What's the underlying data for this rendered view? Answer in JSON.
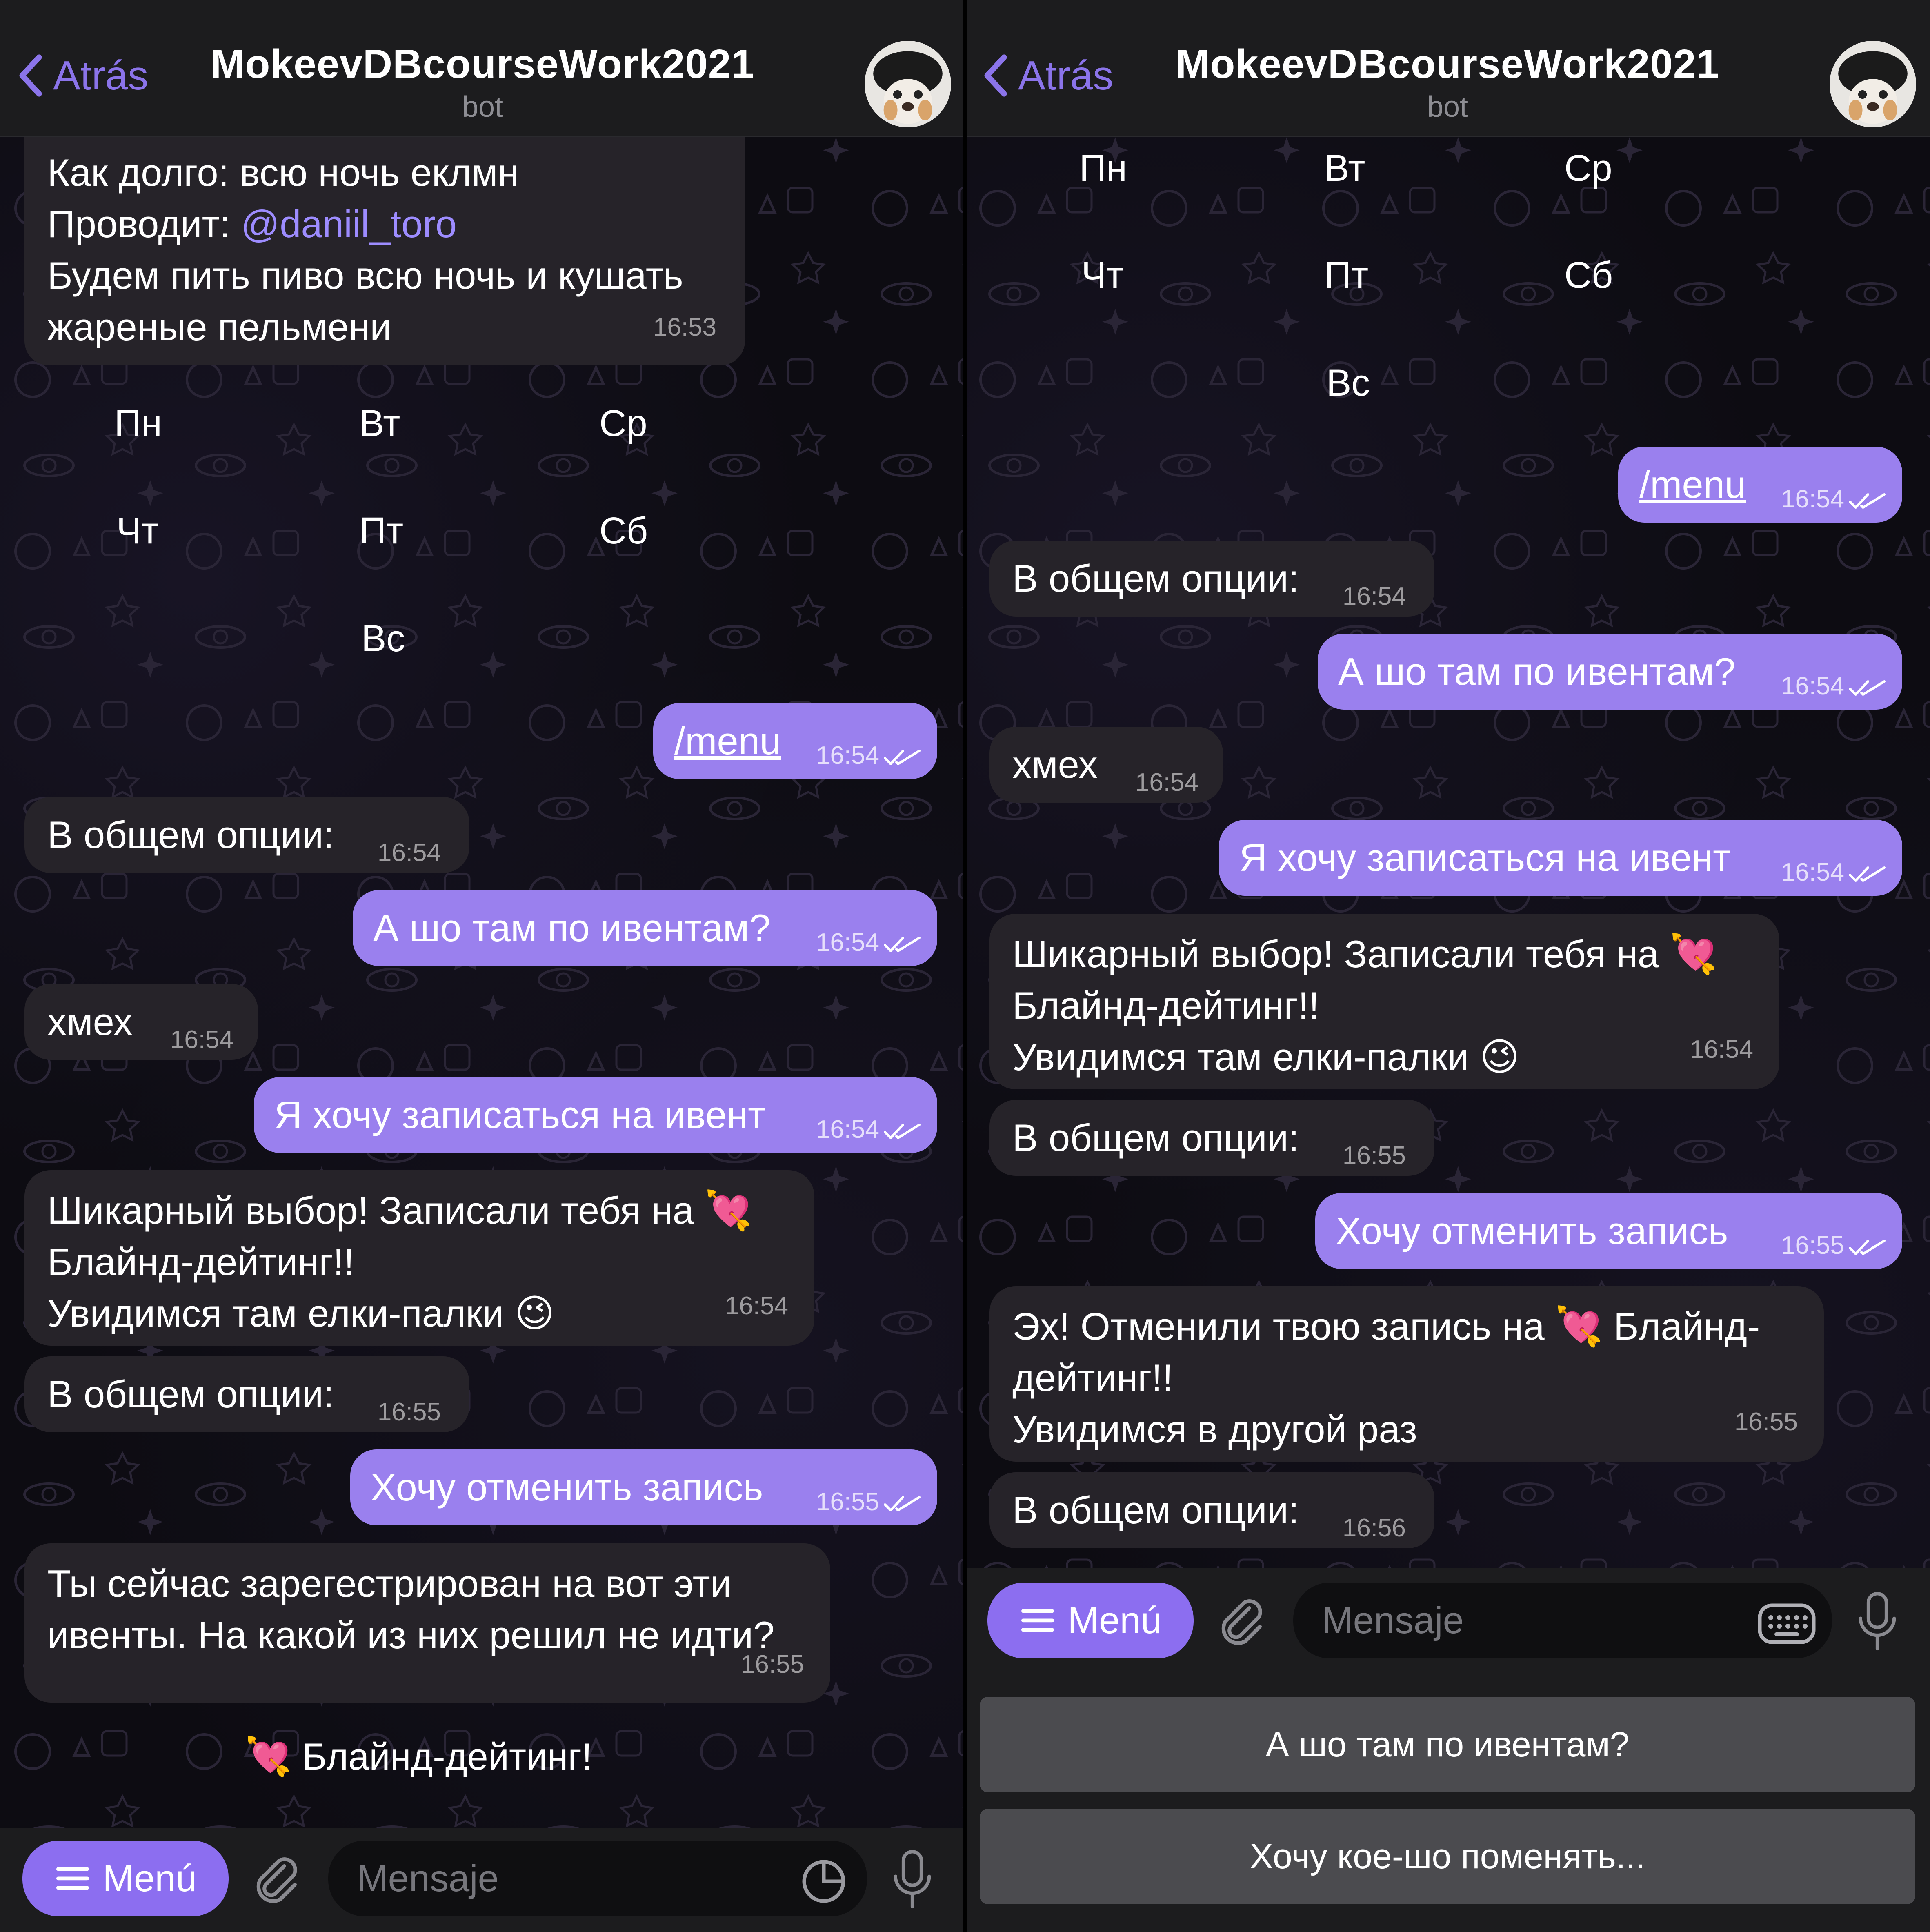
{
  "header": {
    "back_label": "Atrás",
    "title": "MokeevDBcourseWork2021",
    "subtitle": "bot"
  },
  "left": {
    "event_info": {
      "line1": "Как долго: всю ночь еклмн",
      "line2_prefix": "Проводит: ",
      "line2_link": "@daniil_toro",
      "line3": "Будем пить пиво всю ночь и кушать",
      "line4": "жареные пельмени",
      "time": "16:53"
    },
    "days": [
      "Пн",
      "Вт",
      "Ср",
      "Чт",
      "Пт",
      "Сб",
      "Вс"
    ],
    "messages": [
      {
        "text": "/menu",
        "time": "16:54"
      },
      {
        "text": "В общем опции:",
        "time": "16:54"
      },
      {
        "text": "А шо там по ивентам?",
        "time": "16:54"
      },
      {
        "text": "хмех",
        "time": "16:54"
      },
      {
        "text": "Я хочу записаться на ивент",
        "time": "16:54"
      },
      {
        "line1": "Шикарный выбор! Записали тебя на 💘",
        "line2": "Блайнд-дейтинг!!",
        "line3": "Увидимся там елки-палки 😉",
        "time": "16:54"
      },
      {
        "text": "В общем опции:",
        "time": "16:55"
      },
      {
        "text": "Хочу отменить запись",
        "time": "16:55"
      },
      {
        "line1": "Ты сейчас зарегестрирован на вот эти",
        "line2": "ивенты. На какой из них решил не идти?",
        "time": "16:55"
      }
    ],
    "inline_option": "💘 Блайнд-дейтинг!"
  },
  "right": {
    "days": [
      "Пн",
      "Вт",
      "Ср",
      "Чт",
      "Пт",
      "Сб",
      "Вс"
    ],
    "messages": [
      {
        "text": "/menu",
        "time": "16:54"
      },
      {
        "text": "В общем опции:",
        "time": "16:54"
      },
      {
        "text": "А шо там по ивентам?",
        "time": "16:54"
      },
      {
        "text": "хмех",
        "time": "16:54"
      },
      {
        "text": "Я хочу записаться на ивент",
        "time": "16:54"
      },
      {
        "line1": "Шикарный выбор! Записали тебя на 💘",
        "line2": "Блайнд-дейтинг!!",
        "line3": "Увидимся там елки-палки 😉",
        "time": "16:54"
      },
      {
        "text": "В общем опции:",
        "time": "16:55"
      },
      {
        "text": "Хочу отменить запись",
        "time": "16:55"
      },
      {
        "line1": "Эх! Отменили твою запись на 💘 Блайнд-",
        "line2": "дейтинг!!",
        "line3": "Увидимся в другой раз",
        "time": "16:55"
      },
      {
        "text": "В общем опции:",
        "time": "16:56"
      }
    ],
    "keyboard_buttons": [
      "А шо там по ивентам?",
      "Хочу кое-шо поменять..."
    ]
  },
  "input": {
    "menu_label": "Menú",
    "placeholder": "Mensaje"
  },
  "colors": {
    "accent": "#8c6ef0",
    "outgoing_bubble": "#9a80ee",
    "incoming_bubble": "#262329",
    "header_bg": "#1c1c1e",
    "link": "#9d8cff"
  },
  "icons": [
    "chevron-left-icon",
    "bot-avatar",
    "hamburger-icon",
    "paperclip-icon",
    "sticker-icon",
    "keyboard-icon",
    "microphone-icon",
    "double-check-icon"
  ]
}
